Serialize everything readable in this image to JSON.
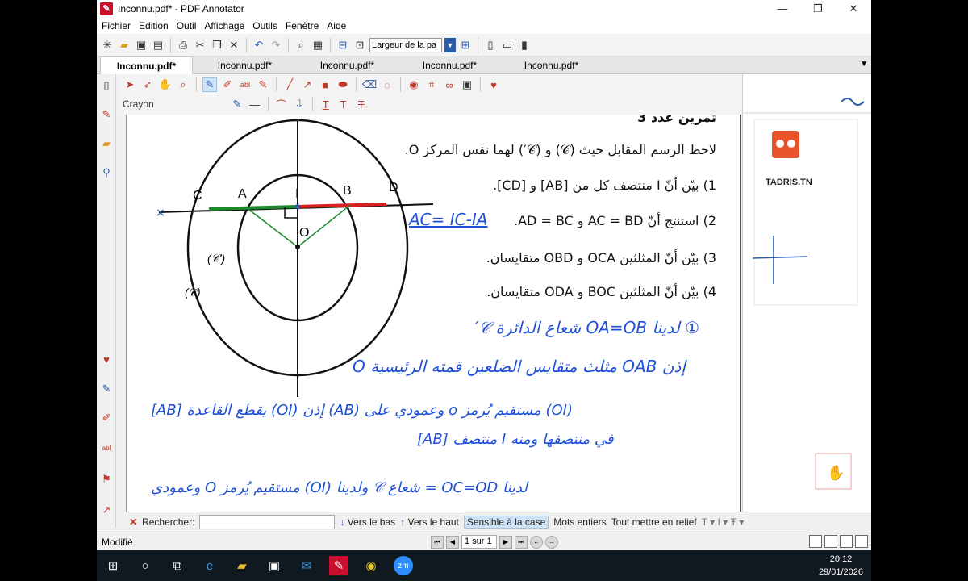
{
  "window": {
    "title": "Inconnu.pdf* - PDF Annotator",
    "min_glyph": "—",
    "max_glyph": "❐",
    "close_glyph": "✕"
  },
  "menu": [
    "Fichier",
    "Edition",
    "Outil",
    "Affichage",
    "Outils",
    "Fenêtre",
    "Aide"
  ],
  "toolbar": {
    "zoom_value": "Largeur de la pa"
  },
  "tabs": [
    "Inconnu.pdf*",
    "Inconnu.pdf*",
    "Inconnu.pdf*",
    "Inconnu.pdf*",
    "Inconnu.pdf*"
  ],
  "tool_label": "Crayon",
  "document": {
    "title_partial": "تمرين عدد 3",
    "line1": "لاحظ الرسم المقابل حيث (𝒞) و (𝒞′) لهما نفس المركز O.",
    "line2": "1) بيّن أنّ I منتصف كل من [AB] و [CD].",
    "line3": "2) استنتج أنّ AC = BD و AD = BC.",
    "line4": "3) بيّن أنّ المثلثين OCA و OBD متقايسان.",
    "line5": "4) بيّن أنّ المثلثين BOC و ODA متقايسان.",
    "figure": {
      "C": "C",
      "A": "A",
      "I": "I",
      "B": "B",
      "D": "D",
      "O": "O",
      "c_prime": "(𝒞′)",
      "c": "(𝒞)"
    },
    "logo": "TADRIS.TN",
    "handwriting": {
      "hw1": "AC= IC-IA",
      "hw2": "① لدينا OA=OB شعاع الدائرة 𝒞′",
      "hw3": "إذن OAB مثلث متقايس الضلعين قمته الرئيسية O",
      "hw4": "(OI) مستقيم يُرمز o وعمودي على (AB) إذن (OI) يقطع القاعدة [AB]",
      "hw5": "في منتصفها ومنه I منتصف [AB]",
      "hw6": "لدينا OC=OD = شعاع 𝒞 ولدينا (OI) مستقيم يُرمز O وعمودي"
    }
  },
  "search": {
    "label": "Rechercher:",
    "down": "Vers le bas",
    "up": "Vers le haut",
    "case": "Sensible à la case",
    "whole": "Mots entiers",
    "highlight": "Tout mettre en relief"
  },
  "status": {
    "text": "Modifié",
    "page": "1 sur 1"
  },
  "clock": {
    "time": "20:12",
    "date": "29/01/2026"
  }
}
